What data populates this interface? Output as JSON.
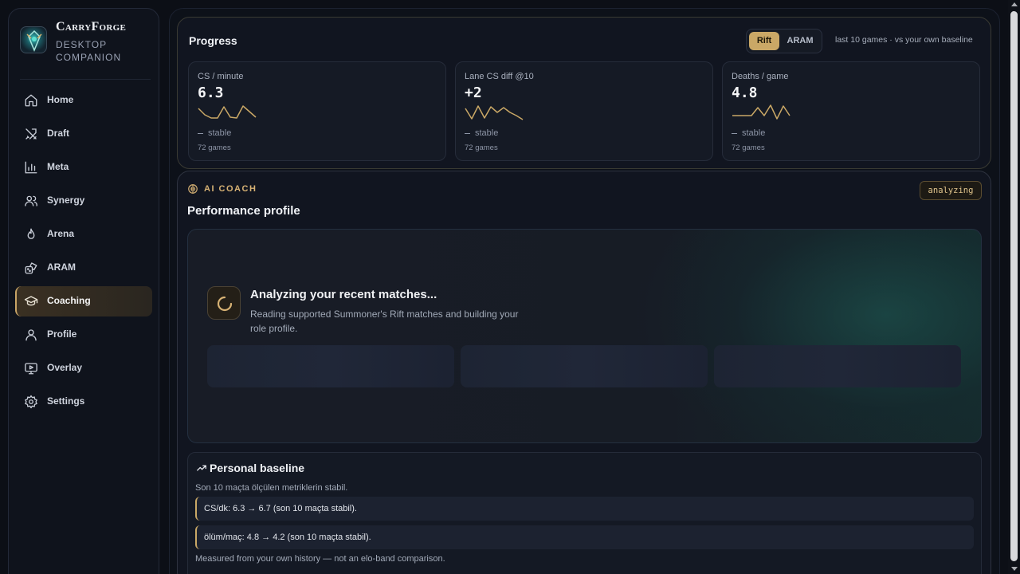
{
  "brand": {
    "name": "CarryForge",
    "subtitle": "Desktop Companion"
  },
  "sidebar": {
    "items": [
      {
        "label": "Home",
        "icon": "home-icon",
        "active": false
      },
      {
        "label": "Draft",
        "icon": "swords-icon",
        "active": false
      },
      {
        "label": "Meta",
        "icon": "bar-chart-icon",
        "active": false
      },
      {
        "label": "Synergy",
        "icon": "users-icon",
        "active": false
      },
      {
        "label": "Arena",
        "icon": "flame-icon",
        "active": false
      },
      {
        "label": "ARAM",
        "icon": "dice-icon",
        "active": false
      },
      {
        "label": "Coaching",
        "icon": "graduation-cap-icon",
        "active": true
      },
      {
        "label": "Profile",
        "icon": "user-icon",
        "active": false
      },
      {
        "label": "Overlay",
        "icon": "monitor-play-icon",
        "active": false
      },
      {
        "label": "Settings",
        "icon": "gear-icon",
        "active": false
      }
    ]
  },
  "progress": {
    "title": "Progress",
    "modes": [
      "Rift",
      "ARAM"
    ],
    "selected_mode": "Rift",
    "hint": "last 10 games · vs your own baseline",
    "cards": [
      {
        "label": "CS / minute",
        "value": "6.3",
        "trend": "stable",
        "games": "72 games",
        "spark": [
          0.75,
          0.35,
          0.15,
          0.15,
          0.85,
          0.2,
          0.15,
          0.9,
          0.55,
          0.2
        ]
      },
      {
        "label": "Lane CS diff @10",
        "value": "+2",
        "trend": "stable",
        "games": "72 games",
        "spark": [
          0.75,
          0.1,
          0.9,
          0.15,
          0.85,
          0.5,
          0.8,
          0.5,
          0.3,
          0.05
        ]
      },
      {
        "label": "Deaths / game",
        "value": "4.8",
        "trend": "stable",
        "games": "72 games",
        "spark": [
          0.3,
          0.3,
          0.3,
          0.3,
          0.8,
          0.3,
          0.95,
          0.1,
          0.9,
          0.3
        ]
      }
    ],
    "accent": "#caa866"
  },
  "coach": {
    "tag": "AI COACH",
    "status": "analyzing",
    "title": "Performance profile",
    "analyzing_title": "Analyzing your recent matches...",
    "analyzing_text": "Reading supported Summoner's Rift matches and building your role profile.",
    "baseline": {
      "title": "Personal baseline",
      "subtitle": "Son 10 maçta ölçülen metriklerin stabil.",
      "insights": [
        "CS/dk: 6.3 → 6.7 (son 10 maçta stabil).",
        "ölüm/maç: 4.8 → 4.2 (son 10 maçta stabil)."
      ],
      "footer": "Measured from your own history — not an elo-band comparison."
    }
  }
}
